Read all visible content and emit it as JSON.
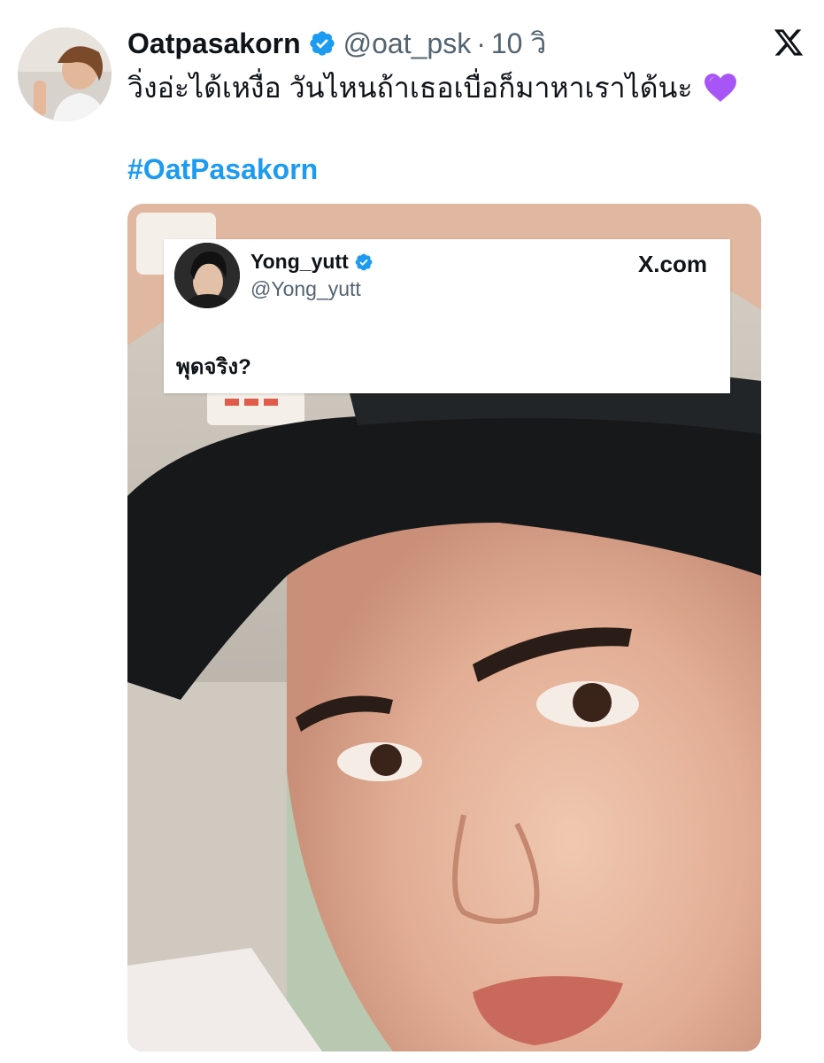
{
  "post": {
    "author": {
      "display_name": "Oatpasakorn",
      "handle": "@oat_psk",
      "verified": true
    },
    "separator": "·",
    "time": "10 วิ",
    "text": "วิ่งอ่ะได้เหงื่อ วันไหนถ้าเธอเบื่อก็มาหาเราได้นะ",
    "emoji": "purple-heart",
    "hashtag": "#OatPasakorn",
    "platform_icon": "x-logo-icon"
  },
  "quoted_card": {
    "author": {
      "display_name": "Yong_yutt",
      "handle": "@Yong_yutt",
      "verified": true
    },
    "brand": "X.com",
    "text": "พุดจริง?"
  },
  "colors": {
    "link": "#1d9bf0",
    "verified": "#1d9bf0",
    "secondary_text": "#536471",
    "primary_text": "#0f1419",
    "emoji_heart": "#a855f7"
  }
}
